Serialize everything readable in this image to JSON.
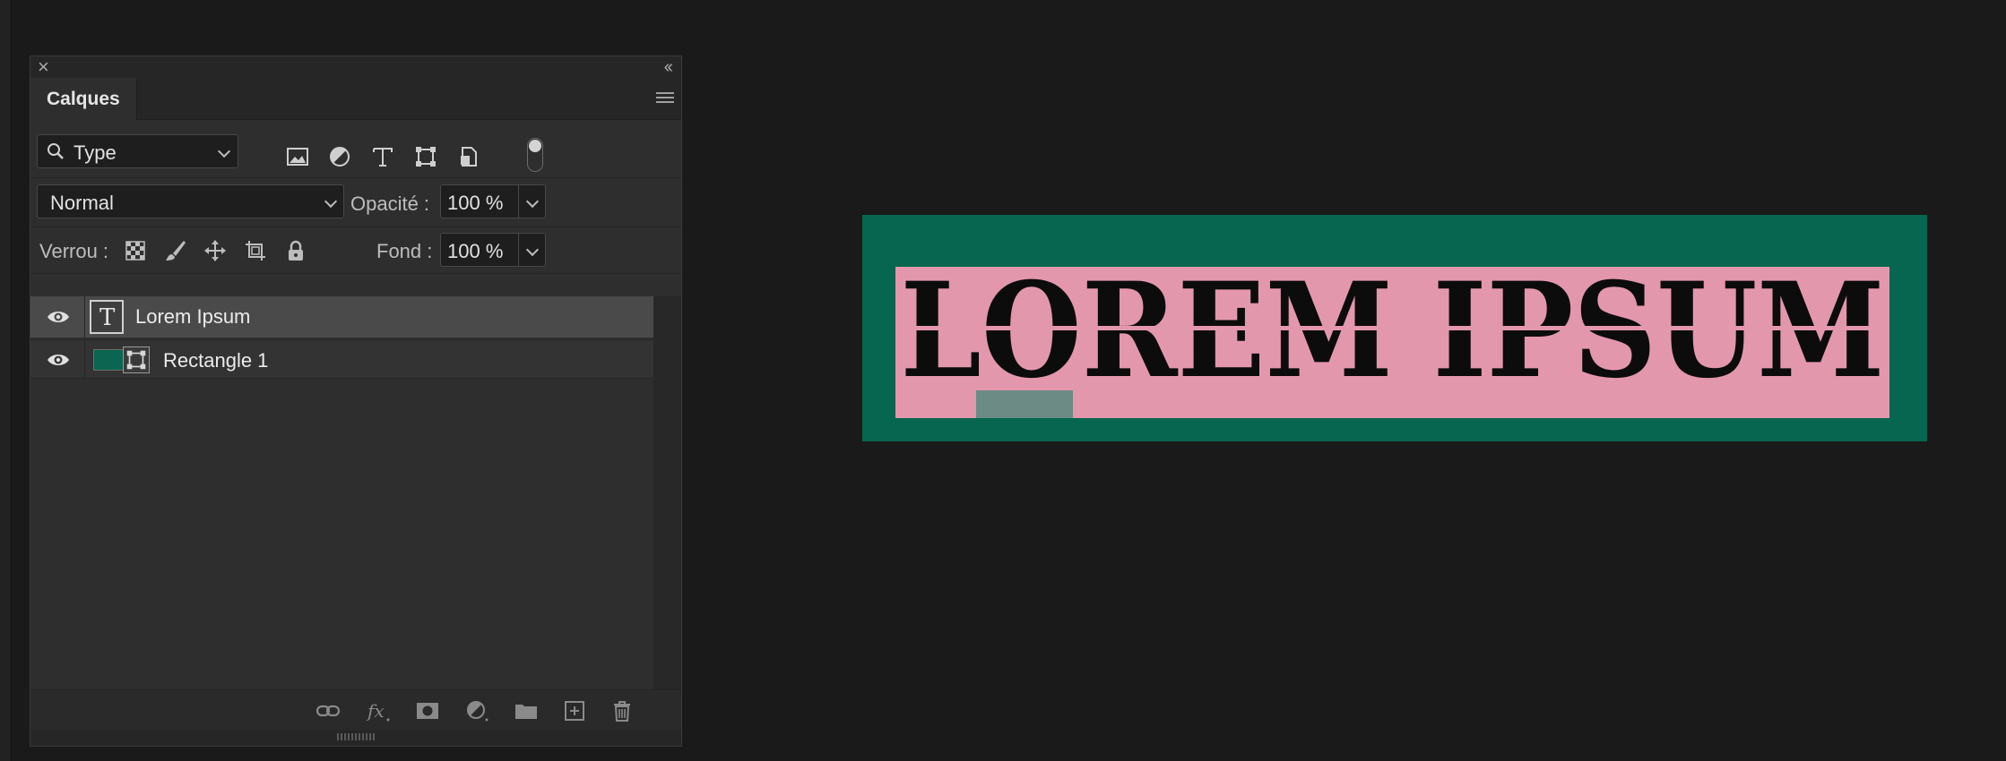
{
  "panel": {
    "tab_label": "Calques",
    "filter": {
      "label": "Type",
      "icons": [
        "image-icon",
        "adjustment-icon",
        "text-icon",
        "shape-icon",
        "smart-object-icon"
      ]
    },
    "blend_mode": "Normal",
    "opacity_label": "Opacité :",
    "opacity_value": "100 %",
    "lock_label": "Verrou :",
    "fill_label": "Fond :",
    "fill_value": "100 %",
    "layers": [
      {
        "name": "Lorem Ipsum",
        "kind": "text",
        "visible": true,
        "selected": true
      },
      {
        "name": "Rectangle 1",
        "kind": "shape",
        "visible": true,
        "selected": false,
        "color": "#0a6650"
      }
    ],
    "footer_icons": [
      "link-icon",
      "fx-icon",
      "mask-icon",
      "adjustment-layer-icon",
      "folder-icon",
      "new-layer-icon",
      "trash-icon"
    ]
  },
  "canvas": {
    "text": "LOREM IPSUM",
    "colors": {
      "background": "#07664f",
      "box": "#e397ad",
      "text": "#0c0c0c",
      "small_rect": "#6b8b84"
    }
  }
}
